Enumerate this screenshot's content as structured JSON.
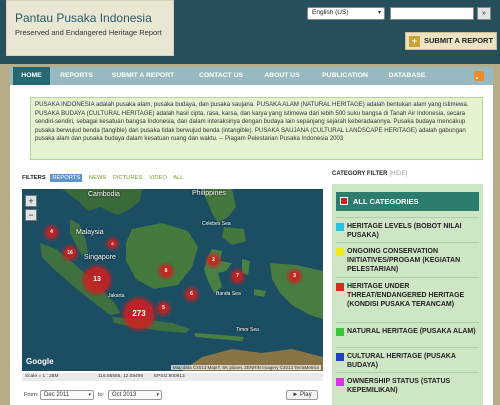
{
  "header": {
    "site_title": "Pantau Pusaka Indonesia",
    "site_subtitle": "Preserved and Endangered Heritage Report",
    "language": "English (US)",
    "search_button": "»",
    "submit_report": "SUBMIT A REPORT",
    "submit_icon": "+"
  },
  "nav": {
    "items": [
      "HOME",
      "REPORTS",
      "SUBMIT A REPORT",
      "CONTACT US",
      "ABOUT US",
      "PUBLICATION",
      "DATABASE"
    ],
    "rss_icon": "rss-icon"
  },
  "intro": "PUSAKA INDONESIA adalah pusaka alam, pusaka budaya, dan pusaka saujana. PUSAKA ALAM (NATURAL HERITAGE) adalah bentukan alam yang istimewa. PUSAKA BUDAYA (CULTURAL HERITAGE) adalah hasil cipta, rasa, karsa, dan karya yang istimewa dari lebih 500 suku bangsa di Tanah Air Indonesia, secara sendiri-sendiri, sebagai kesatuan bangsa Indonesia, dan dalam interaksinya dengan budaya lain sepanjang sejarah keberadaannya. Pusaka budaya mencakup pusaka berwujud benda (tangible) dan pusaka tidak berwujud benda (intangible). PUSAKA SAUJANA (CULTURAL LANDSCAPE HERITAGE) adalah gabungan pusaka alam dan pusaka budaya dalam kesatuan ruang dan waktu. -- Piagam Pelestarian Pusaka Indonesia 2003",
  "filters": {
    "label": "FILTERS",
    "items": [
      "REPORTS",
      "NEWS",
      "PICTURES",
      "VIDEO",
      "ALL"
    ],
    "selected": "REPORTS"
  },
  "map": {
    "labels": {
      "cambodia": "Cambodia",
      "philippines": "Philippines",
      "malaysia": "Malaysia",
      "singapore": "Singapore",
      "celebes_sea": "Celebes Sea",
      "banda_sea": "Banda Sea",
      "jakarta": "Jakarta",
      "timor_sea": "Timor Sea"
    },
    "clusters": [
      "4",
      "16",
      "13",
      "8",
      "2",
      "7",
      "3",
      "6",
      "273",
      "5",
      "6"
    ],
    "zoom_in": "+",
    "zoom_out": "−",
    "google": "Google",
    "attribution": "Map data ©2013 MapIT, SK planet, ZENRIN Imagery ©2013 TerraMetrics",
    "scale": "Scale = 1 : 28M",
    "coords": "116.86566, 12.08499",
    "epsg": "EPSG:900913"
  },
  "timeline": {
    "from_label": "From:",
    "from_value": "Dec 2011",
    "to_label": "to:",
    "to_value": "Oct 2013",
    "play": "► Play"
  },
  "category_filter": {
    "title": "CATEGORY FILTER",
    "hide": "[HIDE]",
    "all": "ALL CATEGORIES",
    "all_color": "#d42020",
    "items": [
      {
        "label": "HERITAGE LEVELS (BOBOT NILAI PUSAKA)",
        "color": "#22c4e6"
      },
      {
        "label": "ONGOING CONSERVATION INITIATIVES/PROGAM (KEGIATAN PELESTARIAN)",
        "color": "#f2e91d"
      },
      {
        "label": "HERITAGE UNDER THREAT/ENDANGERED HERITAGE (KONDISI PUSAKA TERANCAM)",
        "color": "#e12620"
      },
      {
        "label": "NATURAL HERITAGE (PUSAKA ALAM)",
        "color": "#3ac43a"
      },
      {
        "label": "CULTURAL HERITAGE (PUSAKA BUDAYA)",
        "color": "#1f3fc8"
      },
      {
        "label": "OWNERSHIP STATUS (STATUS KEPEMILIKAN)",
        "color": "#e033e0"
      }
    ]
  }
}
